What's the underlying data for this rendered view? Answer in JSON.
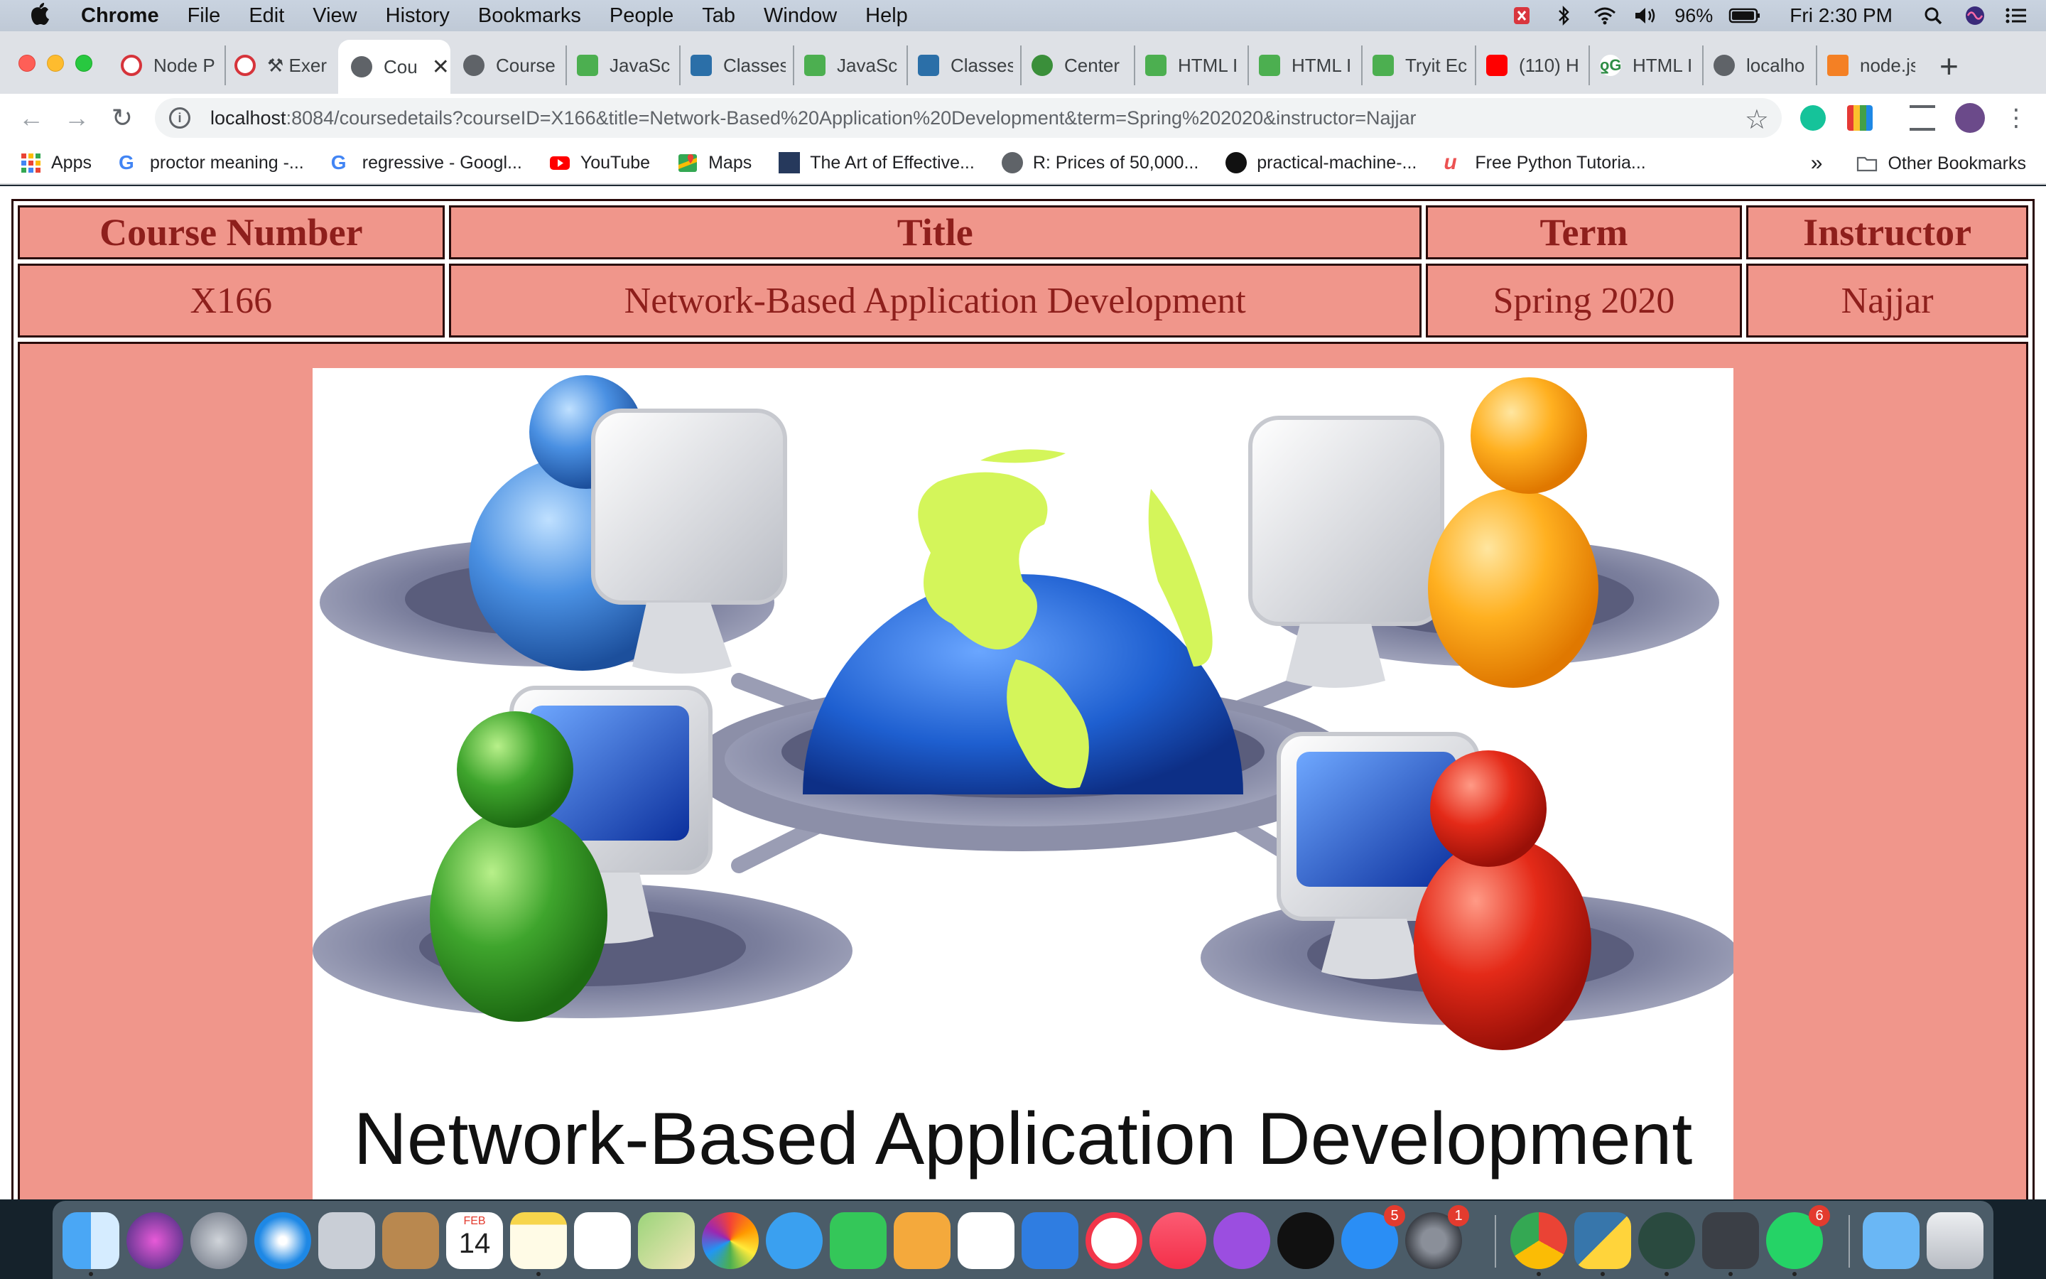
{
  "menubar": {
    "app_name": "Chrome",
    "menus": [
      "File",
      "Edit",
      "View",
      "History",
      "Bookmarks",
      "People",
      "Tab",
      "Window",
      "Help"
    ],
    "battery": "96%",
    "clock": "Fri 2:30 PM"
  },
  "tabs": [
    {
      "label": "Node P",
      "icon": "node-icon"
    },
    {
      "label": "⚒ Exer",
      "icon": "node-icon"
    },
    {
      "label": "Cou",
      "icon": "globe-icon",
      "active": true
    },
    {
      "label": "Course",
      "icon": "globe-icon"
    },
    {
      "label": "JavaSc",
      "icon": "w3schools-icon"
    },
    {
      "label": "Classes",
      "icon": "panther-icon"
    },
    {
      "label": "JavaSc",
      "icon": "w3schools-icon"
    },
    {
      "label": "Classes",
      "icon": "panther-icon"
    },
    {
      "label": "Center",
      "icon": "earth-icon"
    },
    {
      "label": "HTML I",
      "icon": "w3schools-icon"
    },
    {
      "label": "HTML I",
      "icon": "w3schools-icon"
    },
    {
      "label": "Tryit Ec",
      "icon": "w3schools-icon"
    },
    {
      "label": "(110) H",
      "icon": "youtube-icon"
    },
    {
      "label": "HTML I",
      "icon": "geeks-icon"
    },
    {
      "label": "localho",
      "icon": "globe-icon"
    },
    {
      "label": "node.js",
      "icon": "stackoverflow-icon"
    }
  ],
  "address": {
    "host": "localhost",
    "rest": ":8084/coursedetails?courseID=X166&title=Network-Based%20Application%20Development&term=Spring%202020&instructor=Najjar"
  },
  "bookmarks": {
    "items": [
      {
        "label": "Apps",
        "icon": "apps-grid-icon"
      },
      {
        "label": "proctor meaning -...",
        "icon": "google-icon"
      },
      {
        "label": "regressive - Googl...",
        "icon": "google-icon"
      },
      {
        "label": "YouTube",
        "icon": "youtube-icon"
      },
      {
        "label": "Maps",
        "icon": "maps-icon"
      },
      {
        "label": "The Art of Effective...",
        "icon": "book-icon"
      },
      {
        "label": "R: Prices of 50,000...",
        "icon": "globe-icon"
      },
      {
        "label": "practical-machine-...",
        "icon": "github-icon"
      },
      {
        "label": "Free Python Tutoria...",
        "icon": "udemy-icon"
      }
    ],
    "overflow": "»",
    "other": "Other Bookmarks"
  },
  "course": {
    "headers": {
      "number": "Course Number",
      "title": "Title",
      "term": "Term",
      "instructor": "Instructor"
    },
    "row": {
      "number": "X166",
      "title": "Network-Based Application Development",
      "term": "Spring 2020",
      "instructor": "Najjar"
    },
    "image_caption": "Network-Based Application Development"
  },
  "dock": {
    "calendar_month": "FEB",
    "calendar_day": "14",
    "appstore_badge": "5",
    "prefs_badge": "1",
    "whatsapp_badge": "6"
  },
  "colors": {
    "cell_bg": "#f0968b",
    "cell_text": "#8e1f1c",
    "border": "#2a0a0a"
  }
}
